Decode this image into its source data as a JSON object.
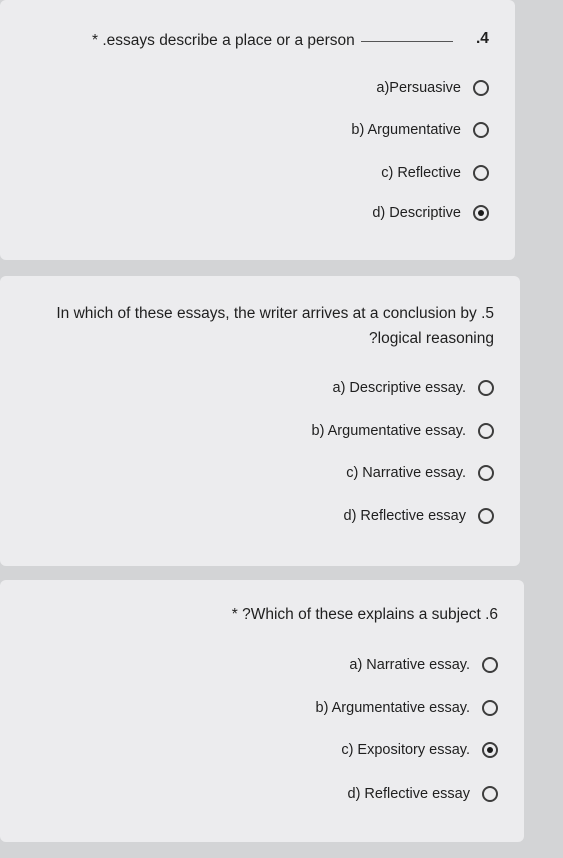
{
  "questions": [
    {
      "number": ".4",
      "text": "* .essays describe a place or a person",
      "options": [
        {
          "label": "a)Persuasive",
          "selected": false
        },
        {
          "label": "b) Argumentative",
          "selected": false
        },
        {
          "label": "c) Reflective",
          "selected": false
        },
        {
          "label": "d) Descriptive",
          "selected": true
        }
      ]
    },
    {
      "line1": "In which of these essays, the writer arrives at a conclusion by .5",
      "line2": "?logical reasoning",
      "options": [
        {
          "label": "a) Descriptive essay.",
          "selected": false
        },
        {
          "label": "b) Argumentative essay.",
          "selected": false
        },
        {
          "label": "c) Narrative essay.",
          "selected": false
        },
        {
          "label": "d) Reflective essay",
          "selected": false
        }
      ]
    },
    {
      "text": "* ?Which of these explains a subject .6",
      "options": [
        {
          "label": "a) Narrative essay.",
          "selected": false
        },
        {
          "label": "b) Argumentative essay.",
          "selected": false
        },
        {
          "label": "c) Expository essay.",
          "selected": true
        },
        {
          "label": "d) Reflective essay",
          "selected": false
        }
      ]
    }
  ]
}
